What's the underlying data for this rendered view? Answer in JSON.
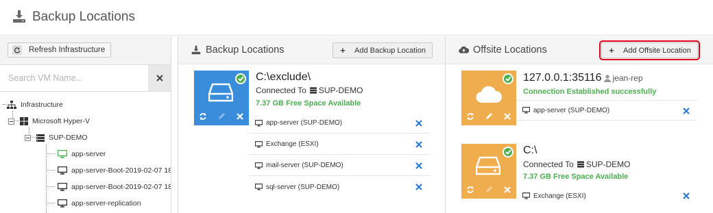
{
  "header": {
    "title": "Backup Locations",
    "icon": "download-drive-icon"
  },
  "sidebar": {
    "refresh_label": "Refresh Infrastructure",
    "search_placeholder": "Search VM Name...",
    "tree": [
      {
        "label": "Infrastructure",
        "icon": "sitemap-icon",
        "level": 0
      },
      {
        "label": "Microsoft Hyper-V",
        "icon": "windows-icon",
        "level": 1
      },
      {
        "label": "SUP-DEMO",
        "icon": "server-icon",
        "level": 2
      },
      {
        "label": "app-server",
        "icon": "monitor-icon",
        "level": 3,
        "active": true
      },
      {
        "label": "app-server-Boot-2019-02-07 18",
        "icon": "monitor-icon",
        "level": 3
      },
      {
        "label": "app-server-Boot-2019-02-07 18",
        "icon": "monitor-icon",
        "level": 3
      },
      {
        "label": "app-server-replication",
        "icon": "monitor-icon",
        "level": 3
      }
    ]
  },
  "backup_panel": {
    "title": "Backup Locations",
    "add_label": "Add Backup Location",
    "location": {
      "path": "C:\\exclude\\",
      "connected_prefix": "Connected To",
      "connected_host": "SUP-DEMO",
      "free_space": "7.37 GB Free Space Available",
      "vms": [
        {
          "name": "app-server (SUP-DEMO)"
        },
        {
          "name": "Exchange (ESXI)"
        },
        {
          "name": "mail-server (SUP-DEMO)"
        },
        {
          "name": "sql-server (SUP-DEMO)"
        }
      ]
    }
  },
  "offsite_panel": {
    "title": "Offsite Locations",
    "add_label": "Add Offsite Location",
    "locations": [
      {
        "path": "127.0.0.1:35116",
        "user": "jean-rep",
        "status": "Connection Established successfully",
        "vms": [
          {
            "name": "app-server (SUP-DEMO)"
          }
        ]
      },
      {
        "path": "C:\\",
        "connected_prefix": "Connected To",
        "connected_host": "SUP-DEMO",
        "free_space": "7.37 GB Free Space Available",
        "vms": [
          {
            "name": "Exchange (ESXI)"
          }
        ]
      }
    ]
  },
  "colors": {
    "backup_card": "#3a8ddb",
    "offsite_card": "#f0ad4e",
    "success": "#4caf50",
    "remove": "#2e7bd6",
    "highlight": "#e0001b"
  }
}
